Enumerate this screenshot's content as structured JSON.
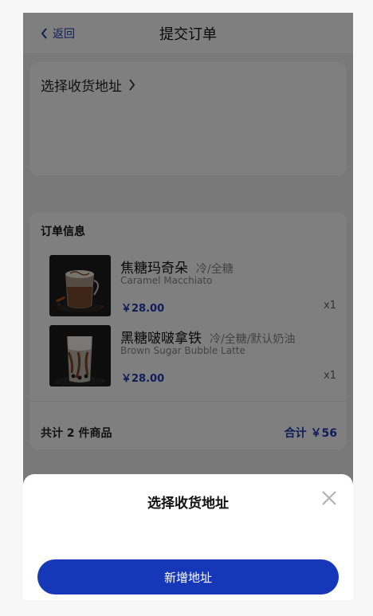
{
  "header": {
    "back_label": "返回",
    "title": "提交订单"
  },
  "address": {
    "select_label": "选择收货地址"
  },
  "order": {
    "title": "订单信息",
    "items": [
      {
        "name": "焦糖玛奇朵",
        "spec": "冷/全糖",
        "english_name": "Caramel Macchiato",
        "price": "￥28.00",
        "qty": "x1"
      },
      {
        "name": "黑糖啵啵拿铁",
        "spec": "冷/全糖/默认奶油",
        "english_name": "Brown Sugar Bubble Latte",
        "price": "￥28.00",
        "qty": "x1"
      }
    ],
    "count_text": "共计 2 件商品",
    "total_text": "合计 ￥56"
  },
  "sheet": {
    "title": "选择收货地址",
    "add_button": "新增地址"
  },
  "colors": {
    "accent": "#1637b8",
    "overlay": "rgba(0,0,0,0.5)"
  }
}
